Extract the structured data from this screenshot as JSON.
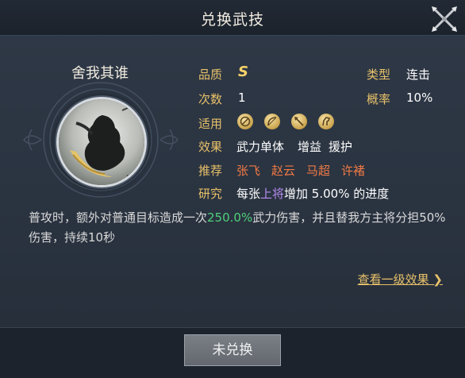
{
  "dialog": {
    "title": "兑换武技"
  },
  "skill": {
    "name": "舍我其谁",
    "quality_label": "品质",
    "quality_value": "S",
    "count_label": "次数",
    "count_value": "1",
    "applies_label": "适用",
    "applies_icons": [
      "shield-icon",
      "bow-icon",
      "spear-icon",
      "horse-icon"
    ],
    "effect_label": "效果",
    "effect_values": [
      "武力单体",
      "增益",
      "援护"
    ],
    "recommend_label": "推荐",
    "recommend_values": [
      "张飞",
      "赵云",
      "马超",
      "许褚"
    ],
    "research_label": "研究",
    "research_prefix": "每张",
    "research_highlight": "上将",
    "research_suffix": "增加 5.00% 的进度",
    "type_label": "类型",
    "type_value": "连击",
    "chance_label": "概率",
    "chance_value": "10%"
  },
  "description": {
    "part1": "普攻时，额外对普通目标造成一次",
    "highlight": "250.0%",
    "part2": "武力伤害，并且替我方主将分担50%伤害，持续10秒"
  },
  "link": {
    "label": "查看一级效果"
  },
  "footer": {
    "button_label": "未兑换"
  },
  "colors": {
    "label_gold": "#e8c16a",
    "recommend_orange": "#ef7a45",
    "highlight_purple": "#b68cf0",
    "highlight_green": "#4fd07a"
  }
}
